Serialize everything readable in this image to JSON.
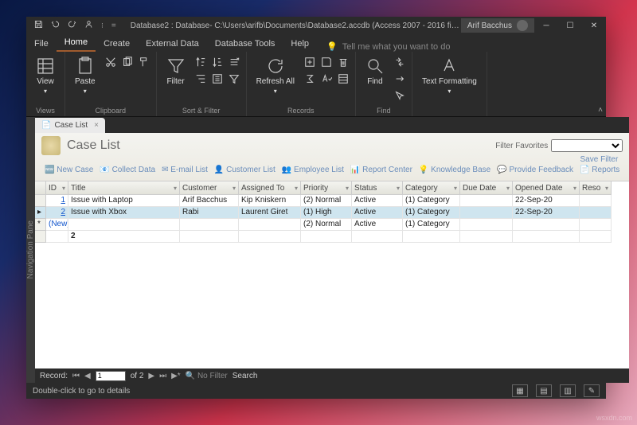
{
  "titlebar": {
    "title": "Database2 : Database- C:\\Users\\arifb\\Documents\\Database2.accdb  (Access 2007 - 2016 file f…",
    "user": "Arif Bacchus"
  },
  "tabs": [
    "File",
    "Home",
    "Create",
    "External Data",
    "Database Tools",
    "Help"
  ],
  "tell_me": "Tell me what you want to do",
  "ribbon": {
    "views": {
      "label": "Views",
      "view": "View"
    },
    "clipboard": {
      "label": "Clipboard",
      "paste": "Paste"
    },
    "sort": {
      "label": "Sort & Filter",
      "filter": "Filter"
    },
    "records": {
      "label": "Records",
      "refresh": "Refresh All"
    },
    "find_grp": {
      "label": "Find",
      "find": "Find"
    },
    "text": {
      "label": "",
      "format": "Text Formatting"
    }
  },
  "nav_pane": "Navigation Pane",
  "object_tab": "Case List",
  "form": {
    "title": "Case List",
    "filter_fav": "Filter Favorites",
    "save_filter": "Save Filter",
    "cmds": [
      "🆕 New Case",
      "📧 Collect Data",
      "✉ E-mail List",
      "👤 Customer List",
      "👥 Employee List",
      "📊 Report Center",
      "💡 Knowledge Base",
      "💬 Provide Feedback",
      "📄 Reports"
    ]
  },
  "columns": [
    "",
    "ID",
    "Title",
    "Customer",
    "Assigned To",
    "Priority",
    "Status",
    "Category",
    "Due Date",
    "Opened Date",
    "Reso"
  ],
  "rows": [
    {
      "id": "1",
      "title": "Issue with Laptop",
      "customer": "Arif Bacchus",
      "assigned": "Kip Kniskern",
      "priority": "(2) Normal",
      "status": "Active",
      "category": "(1) Category",
      "due": "",
      "opened": "22-Sep-20"
    },
    {
      "id": "2",
      "title": "Issue with Xbox",
      "customer": "Rabi",
      "assigned": "Laurent Giret",
      "priority": "(1) High",
      "status": "Active",
      "category": "(1) Category",
      "due": "",
      "opened": "22-Sep-20",
      "selected": true
    },
    {
      "id": "(New)",
      "title": "",
      "customer": "",
      "assigned": "",
      "priority": "(2) Normal",
      "status": "Active",
      "category": "(1) Category",
      "due": "",
      "opened": "",
      "new": true
    }
  ],
  "total": "2",
  "recnav": {
    "label": "Record:",
    "pos": "1",
    "of": "of 2",
    "nofilter": "No Filter",
    "search": "Search"
  },
  "status": "Double-click to go to details",
  "watermark": "wsxdn.com"
}
